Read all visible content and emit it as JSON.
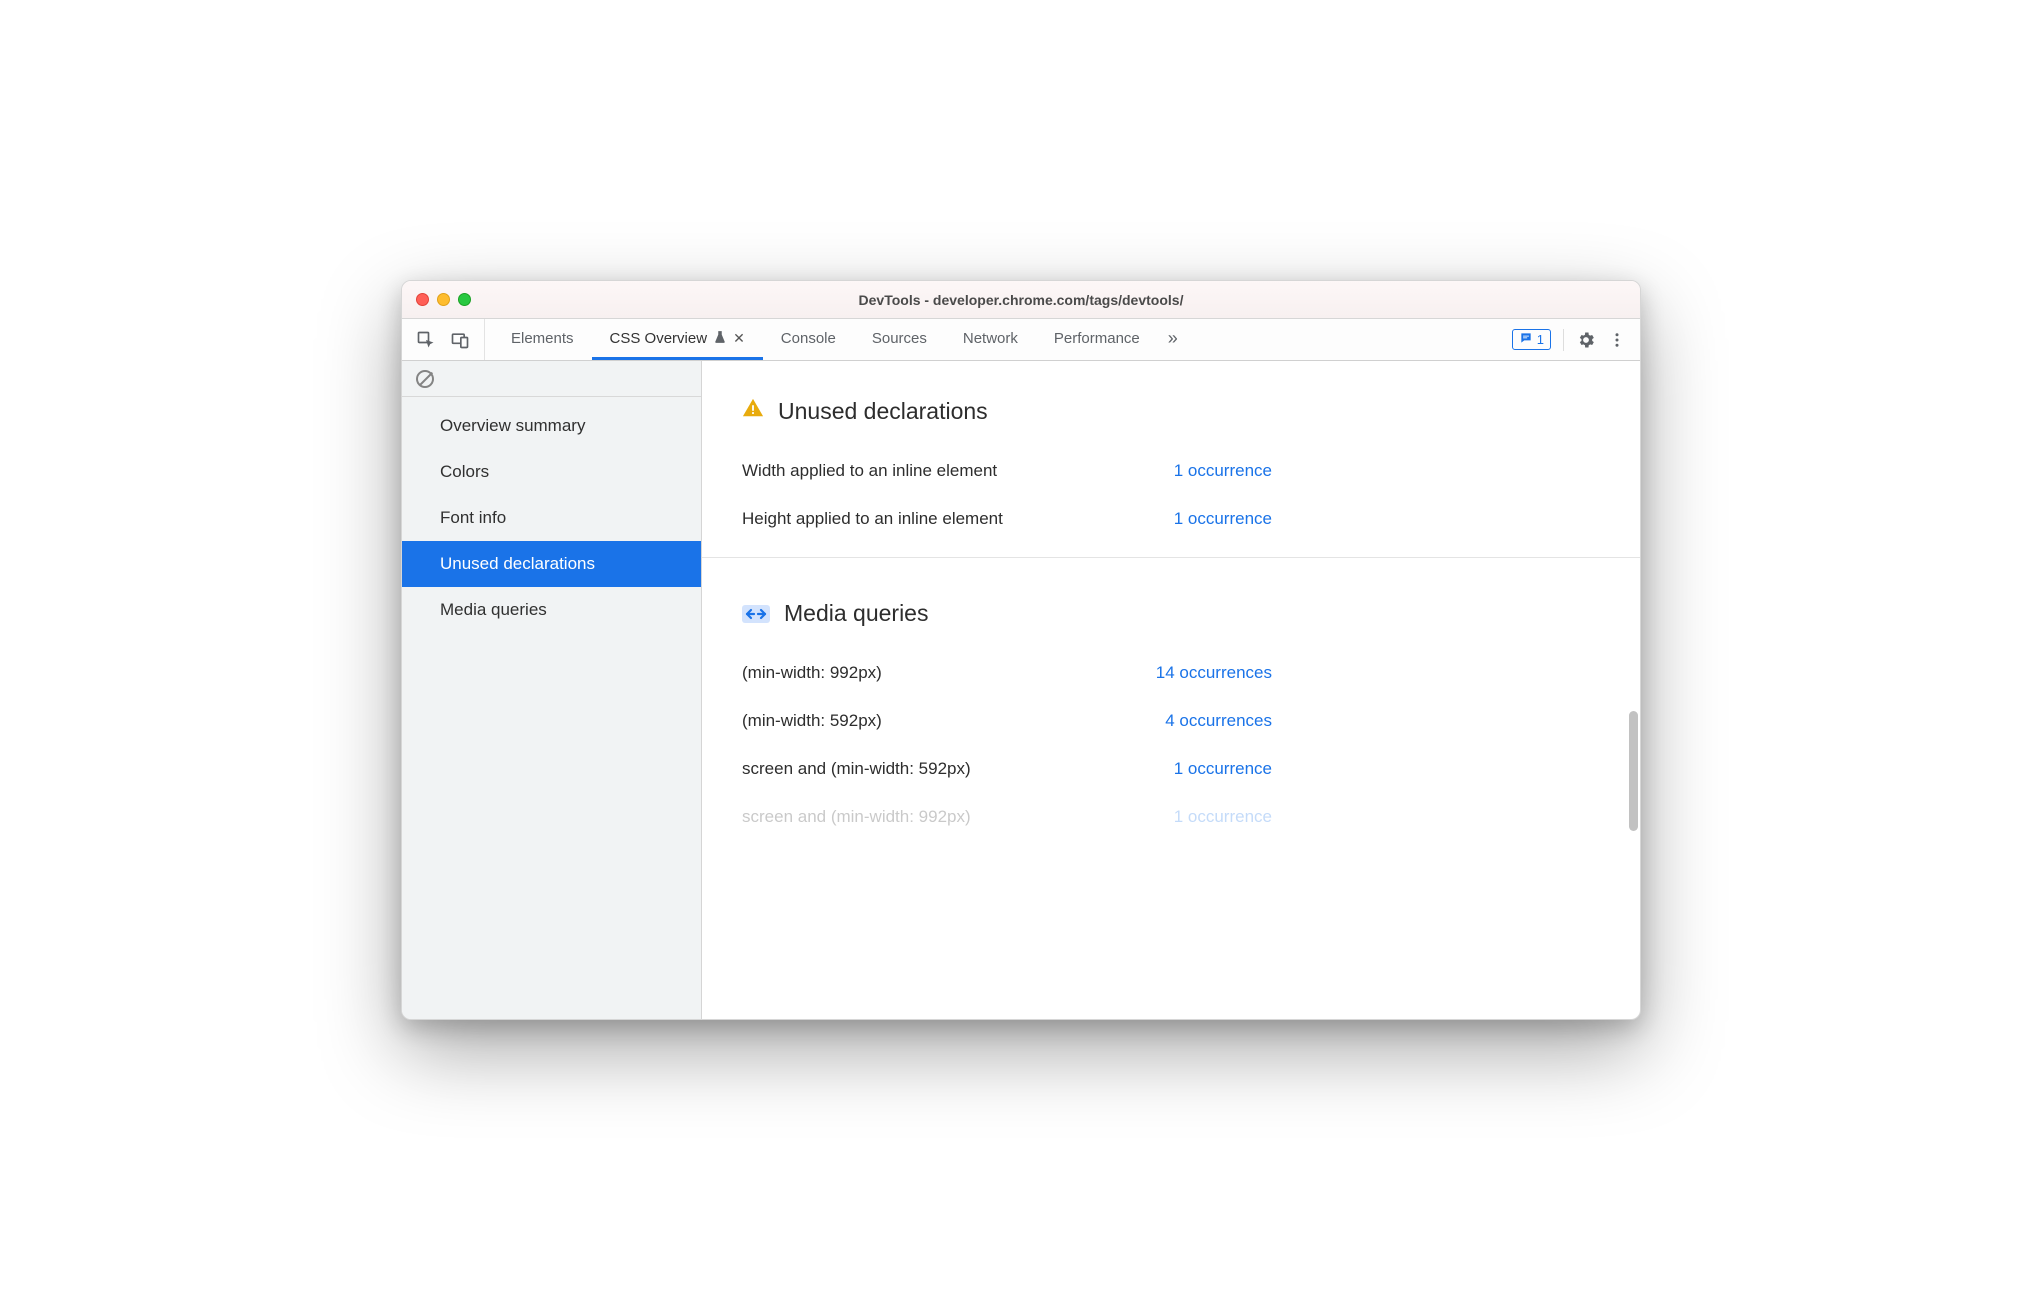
{
  "window": {
    "title": "DevTools - developer.chrome.com/tags/devtools/"
  },
  "tabs": {
    "items": [
      {
        "label": "Elements"
      },
      {
        "label": "CSS Overview"
      },
      {
        "label": "Console"
      },
      {
        "label": "Sources"
      },
      {
        "label": "Network"
      },
      {
        "label": "Performance"
      }
    ],
    "active_index": 1
  },
  "toolbar": {
    "messages_count": "1"
  },
  "sidebar": {
    "items": [
      {
        "label": "Overview summary"
      },
      {
        "label": "Colors"
      },
      {
        "label": "Font info"
      },
      {
        "label": "Unused declarations"
      },
      {
        "label": "Media queries"
      }
    ],
    "selected_index": 3
  },
  "sections": {
    "unused": {
      "title": "Unused declarations",
      "rows": [
        {
          "label": "Width applied to an inline element",
          "occ": "1 occurrence",
          "bar": 140
        },
        {
          "label": "Height applied to an inline element",
          "occ": "1 occurrence",
          "bar": 140
        }
      ]
    },
    "mq": {
      "title": "Media queries",
      "rows": [
        {
          "label": "(min-width: 992px)",
          "occ": "14 occurrences",
          "bar": 180
        },
        {
          "label": "(min-width: 592px)",
          "occ": "4 occurrences",
          "bar": 50
        },
        {
          "label": "screen and (min-width: 592px)",
          "occ": "1 occurrence",
          "bar": 14
        },
        {
          "label": "screen and (min-width: 992px)",
          "occ": "1 occurrence",
          "bar": 14
        }
      ]
    }
  }
}
